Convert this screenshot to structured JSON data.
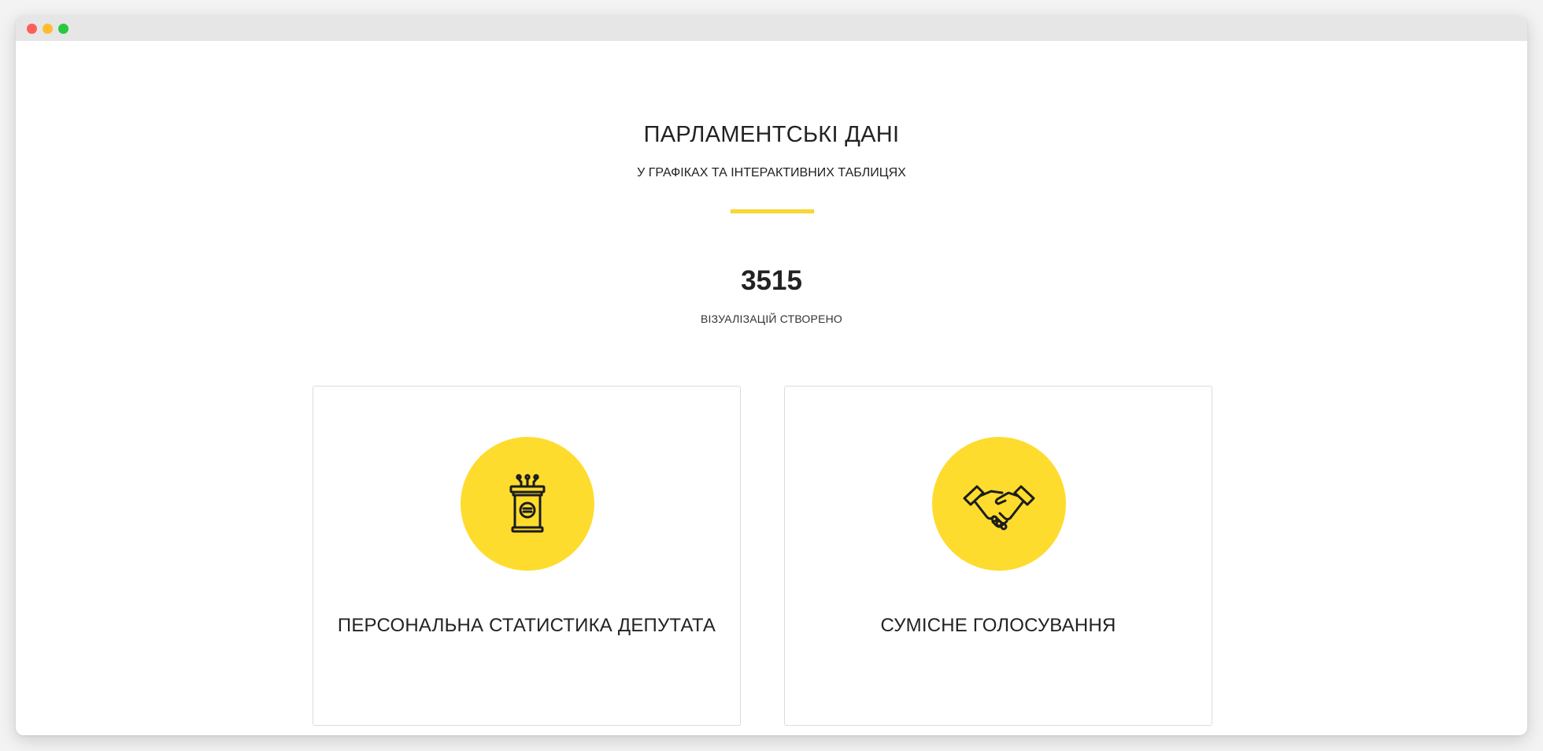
{
  "header": {
    "title": "ПАРЛАМЕНТСЬКІ ДАНІ",
    "subtitle": "У ГРАФІКАХ ТА ІНТЕРАКТИВНИХ ТАБЛИЦЯХ"
  },
  "stats": {
    "count": "3515",
    "label": "ВІЗУАЛІЗАЦІЙ СТВОРЕНО"
  },
  "cards": [
    {
      "title": "ПЕРСОНАЛЬНА СТАТИСТИКА ДЕПУТАТА",
      "icon": "podium-icon"
    },
    {
      "title": "СУМІСНЕ ГОЛОСУВАННЯ",
      "icon": "handshake-icon"
    }
  ],
  "colors": {
    "accent": "#fedc2e",
    "text": "#222222"
  }
}
